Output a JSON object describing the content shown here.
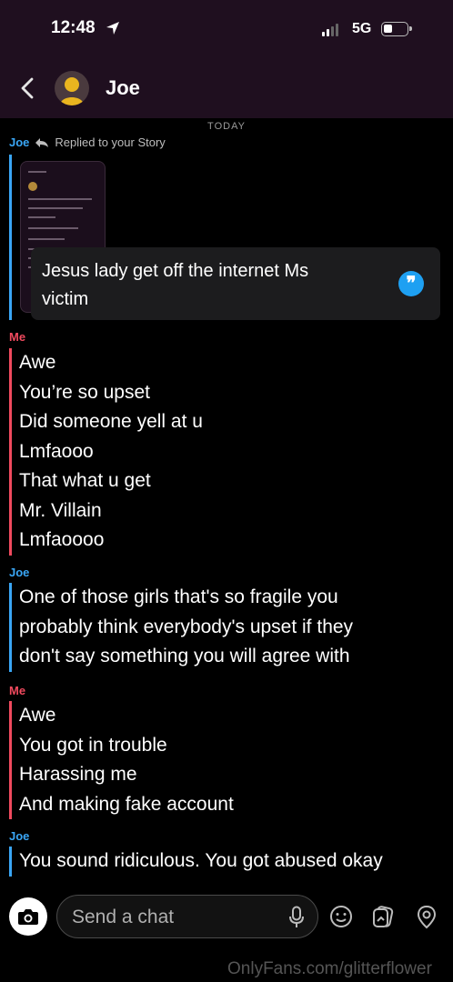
{
  "status_bar": {
    "time": "12:48",
    "network": "5G"
  },
  "header": {
    "contact_name": "Joe"
  },
  "chat": {
    "date_divider": "TODAY",
    "story_reply": {
      "sender": "Joe",
      "reply_label": "Replied to your Story",
      "quote_lines": [
        "Jesus lady get off the internet Ms",
        "victim"
      ]
    },
    "messages": [
      {
        "sender": "Me",
        "lines": [
          "Awe",
          "You’re so upset",
          "Did someone yell at u",
          "Lmfaooo",
          "That what u get",
          "Mr. Villain",
          "Lmfaoooo"
        ]
      },
      {
        "sender": "Joe",
        "lines": [
          "One of those girls that's so fragile you",
          "probably think everybody's upset if they",
          "don't say something you will agree with"
        ]
      },
      {
        "sender": "Me",
        "lines": [
          "Awe",
          "You got in trouble",
          "Harassing me",
          "And making fake account"
        ]
      },
      {
        "sender": "Joe",
        "lines": [
          "You sound ridiculous. You got abused okay"
        ]
      }
    ]
  },
  "composer": {
    "placeholder": "Send a chat"
  },
  "watermark": "OnlyFans.com/glitterflower",
  "colors": {
    "joe_accent": "#3aa6f5",
    "me_accent": "#f04a5e",
    "header_bg": "#1f0f1f",
    "quote_icon": "#1ea0f2"
  },
  "icons": [
    "location-arrow-icon",
    "signal-icon",
    "battery-icon",
    "back-chevron-icon",
    "bitmoji-avatar",
    "reply-arrow-icon",
    "quote-icon",
    "camera-icon",
    "microphone-icon",
    "smiley-icon",
    "sticker-icon",
    "location-pin-icon"
  ]
}
